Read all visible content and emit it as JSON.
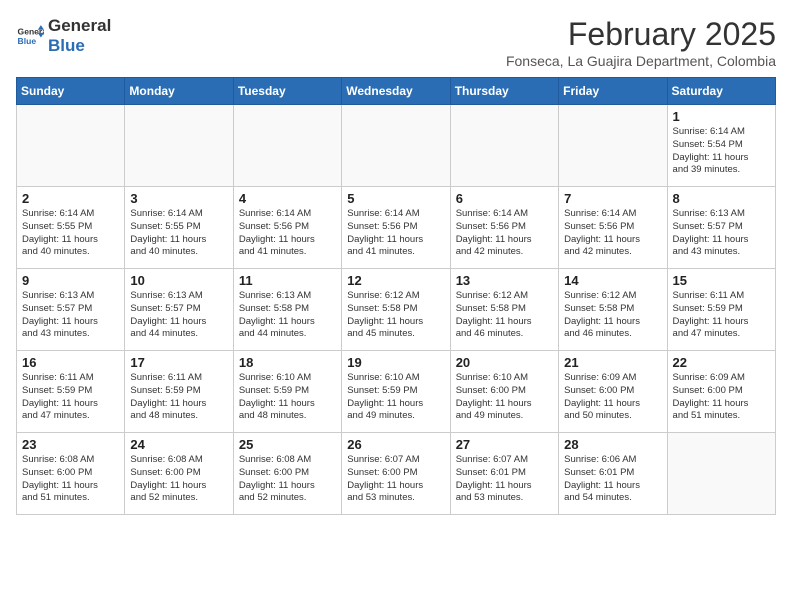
{
  "header": {
    "logo_line1": "General",
    "logo_line2": "Blue",
    "month_year": "February 2025",
    "location": "Fonseca, La Guajira Department, Colombia"
  },
  "weekdays": [
    "Sunday",
    "Monday",
    "Tuesday",
    "Wednesday",
    "Thursday",
    "Friday",
    "Saturday"
  ],
  "weeks": [
    [
      {
        "day": "",
        "info": ""
      },
      {
        "day": "",
        "info": ""
      },
      {
        "day": "",
        "info": ""
      },
      {
        "day": "",
        "info": ""
      },
      {
        "day": "",
        "info": ""
      },
      {
        "day": "",
        "info": ""
      },
      {
        "day": "1",
        "info": "Sunrise: 6:14 AM\nSunset: 5:54 PM\nDaylight: 11 hours\nand 39 minutes."
      }
    ],
    [
      {
        "day": "2",
        "info": "Sunrise: 6:14 AM\nSunset: 5:55 PM\nDaylight: 11 hours\nand 40 minutes."
      },
      {
        "day": "3",
        "info": "Sunrise: 6:14 AM\nSunset: 5:55 PM\nDaylight: 11 hours\nand 40 minutes."
      },
      {
        "day": "4",
        "info": "Sunrise: 6:14 AM\nSunset: 5:56 PM\nDaylight: 11 hours\nand 41 minutes."
      },
      {
        "day": "5",
        "info": "Sunrise: 6:14 AM\nSunset: 5:56 PM\nDaylight: 11 hours\nand 41 minutes."
      },
      {
        "day": "6",
        "info": "Sunrise: 6:14 AM\nSunset: 5:56 PM\nDaylight: 11 hours\nand 42 minutes."
      },
      {
        "day": "7",
        "info": "Sunrise: 6:14 AM\nSunset: 5:56 PM\nDaylight: 11 hours\nand 42 minutes."
      },
      {
        "day": "8",
        "info": "Sunrise: 6:13 AM\nSunset: 5:57 PM\nDaylight: 11 hours\nand 43 minutes."
      }
    ],
    [
      {
        "day": "9",
        "info": "Sunrise: 6:13 AM\nSunset: 5:57 PM\nDaylight: 11 hours\nand 43 minutes."
      },
      {
        "day": "10",
        "info": "Sunrise: 6:13 AM\nSunset: 5:57 PM\nDaylight: 11 hours\nand 44 minutes."
      },
      {
        "day": "11",
        "info": "Sunrise: 6:13 AM\nSunset: 5:58 PM\nDaylight: 11 hours\nand 44 minutes."
      },
      {
        "day": "12",
        "info": "Sunrise: 6:12 AM\nSunset: 5:58 PM\nDaylight: 11 hours\nand 45 minutes."
      },
      {
        "day": "13",
        "info": "Sunrise: 6:12 AM\nSunset: 5:58 PM\nDaylight: 11 hours\nand 46 minutes."
      },
      {
        "day": "14",
        "info": "Sunrise: 6:12 AM\nSunset: 5:58 PM\nDaylight: 11 hours\nand 46 minutes."
      },
      {
        "day": "15",
        "info": "Sunrise: 6:11 AM\nSunset: 5:59 PM\nDaylight: 11 hours\nand 47 minutes."
      }
    ],
    [
      {
        "day": "16",
        "info": "Sunrise: 6:11 AM\nSunset: 5:59 PM\nDaylight: 11 hours\nand 47 minutes."
      },
      {
        "day": "17",
        "info": "Sunrise: 6:11 AM\nSunset: 5:59 PM\nDaylight: 11 hours\nand 48 minutes."
      },
      {
        "day": "18",
        "info": "Sunrise: 6:10 AM\nSunset: 5:59 PM\nDaylight: 11 hours\nand 48 minutes."
      },
      {
        "day": "19",
        "info": "Sunrise: 6:10 AM\nSunset: 5:59 PM\nDaylight: 11 hours\nand 49 minutes."
      },
      {
        "day": "20",
        "info": "Sunrise: 6:10 AM\nSunset: 6:00 PM\nDaylight: 11 hours\nand 49 minutes."
      },
      {
        "day": "21",
        "info": "Sunrise: 6:09 AM\nSunset: 6:00 PM\nDaylight: 11 hours\nand 50 minutes."
      },
      {
        "day": "22",
        "info": "Sunrise: 6:09 AM\nSunset: 6:00 PM\nDaylight: 11 hours\nand 51 minutes."
      }
    ],
    [
      {
        "day": "23",
        "info": "Sunrise: 6:08 AM\nSunset: 6:00 PM\nDaylight: 11 hours\nand 51 minutes."
      },
      {
        "day": "24",
        "info": "Sunrise: 6:08 AM\nSunset: 6:00 PM\nDaylight: 11 hours\nand 52 minutes."
      },
      {
        "day": "25",
        "info": "Sunrise: 6:08 AM\nSunset: 6:00 PM\nDaylight: 11 hours\nand 52 minutes."
      },
      {
        "day": "26",
        "info": "Sunrise: 6:07 AM\nSunset: 6:00 PM\nDaylight: 11 hours\nand 53 minutes."
      },
      {
        "day": "27",
        "info": "Sunrise: 6:07 AM\nSunset: 6:01 PM\nDaylight: 11 hours\nand 53 minutes."
      },
      {
        "day": "28",
        "info": "Sunrise: 6:06 AM\nSunset: 6:01 PM\nDaylight: 11 hours\nand 54 minutes."
      },
      {
        "day": "",
        "info": ""
      }
    ]
  ]
}
